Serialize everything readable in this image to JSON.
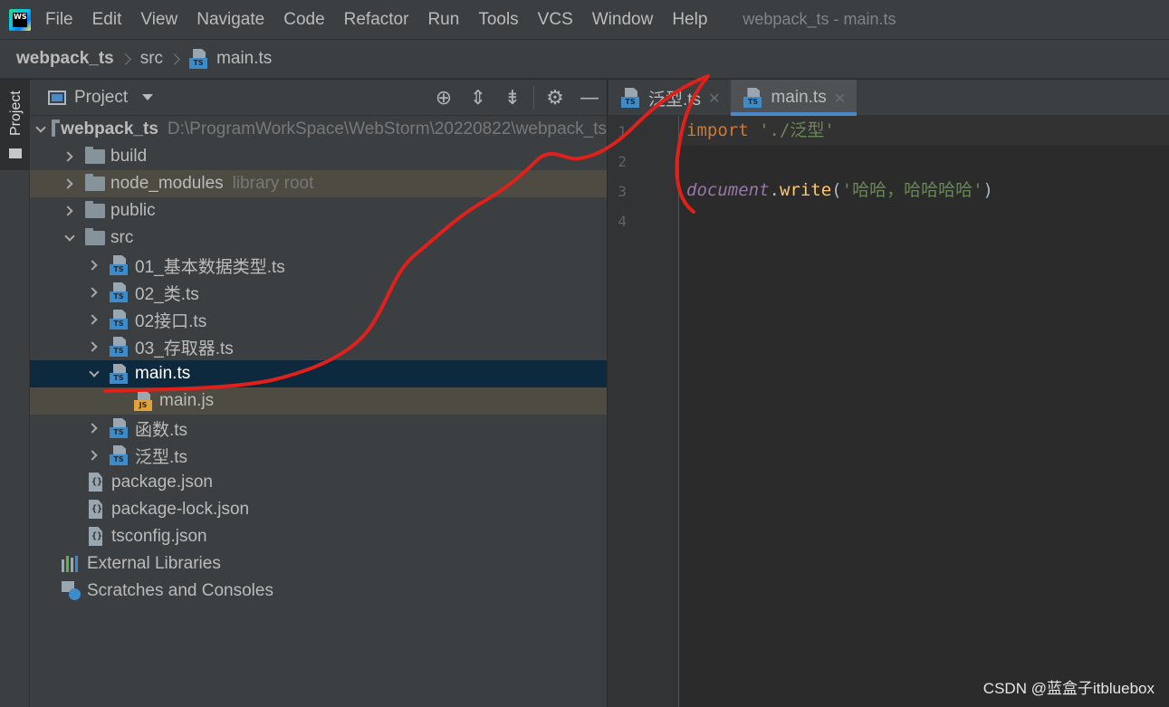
{
  "menubar": {
    "items": [
      {
        "label": "File"
      },
      {
        "label": "Edit"
      },
      {
        "label": "View"
      },
      {
        "label": "Navigate"
      },
      {
        "label": "Code"
      },
      {
        "label": "Refactor"
      },
      {
        "label": "Run"
      },
      {
        "label": "Tools"
      },
      {
        "label": "VCS"
      },
      {
        "label": "Window"
      },
      {
        "label": "Help"
      }
    ],
    "window_title": "webpack_ts - main.ts",
    "logo_text": "WS"
  },
  "breadcrumb": {
    "items": [
      "webpack_ts",
      "src",
      "main.ts"
    ]
  },
  "tool_strip": {
    "project_label": "Project"
  },
  "project_panel": {
    "title": "Project",
    "tree": [
      {
        "label": "webpack_ts",
        "hint": "D:\\ProgramWorkSpace\\WebStorm\\20220822\\webpack_ts"
      },
      {
        "label": "build"
      },
      {
        "label": "node_modules",
        "hint": "library root"
      },
      {
        "label": "public"
      },
      {
        "label": "src"
      },
      {
        "label": "01_基本数据类型.ts"
      },
      {
        "label": "02_类.ts"
      },
      {
        "label": "02接口.ts"
      },
      {
        "label": "03_存取器.ts"
      },
      {
        "label": "main.ts"
      },
      {
        "label": "main.js"
      },
      {
        "label": "函数.ts"
      },
      {
        "label": "泛型.ts"
      },
      {
        "label": "package.json"
      },
      {
        "label": "package-lock.json"
      },
      {
        "label": "tsconfig.json"
      },
      {
        "label": "External Libraries"
      },
      {
        "label": "Scratches and Consoles"
      }
    ]
  },
  "editor": {
    "tabs": [
      {
        "label": "泛型.ts",
        "active": false
      },
      {
        "label": "main.ts",
        "active": true
      }
    ],
    "line_numbers": [
      "1",
      "2",
      "3",
      "4"
    ],
    "lines": {
      "l1_kw": "import",
      "l1_str": "'./泛型'",
      "l3_obj": "document",
      "l3_dot": ".",
      "l3_fn": "write",
      "l3_open": "(",
      "l3_str": "'哈哈，哈哈哈哈'",
      "l3_close": ")"
    }
  },
  "watermark": "CSDN @蓝盒子itbluebox",
  "colors": {
    "selection": "#0d293e",
    "excluded_row": "#4e4b42",
    "annotation_stroke": "#e0201b"
  }
}
